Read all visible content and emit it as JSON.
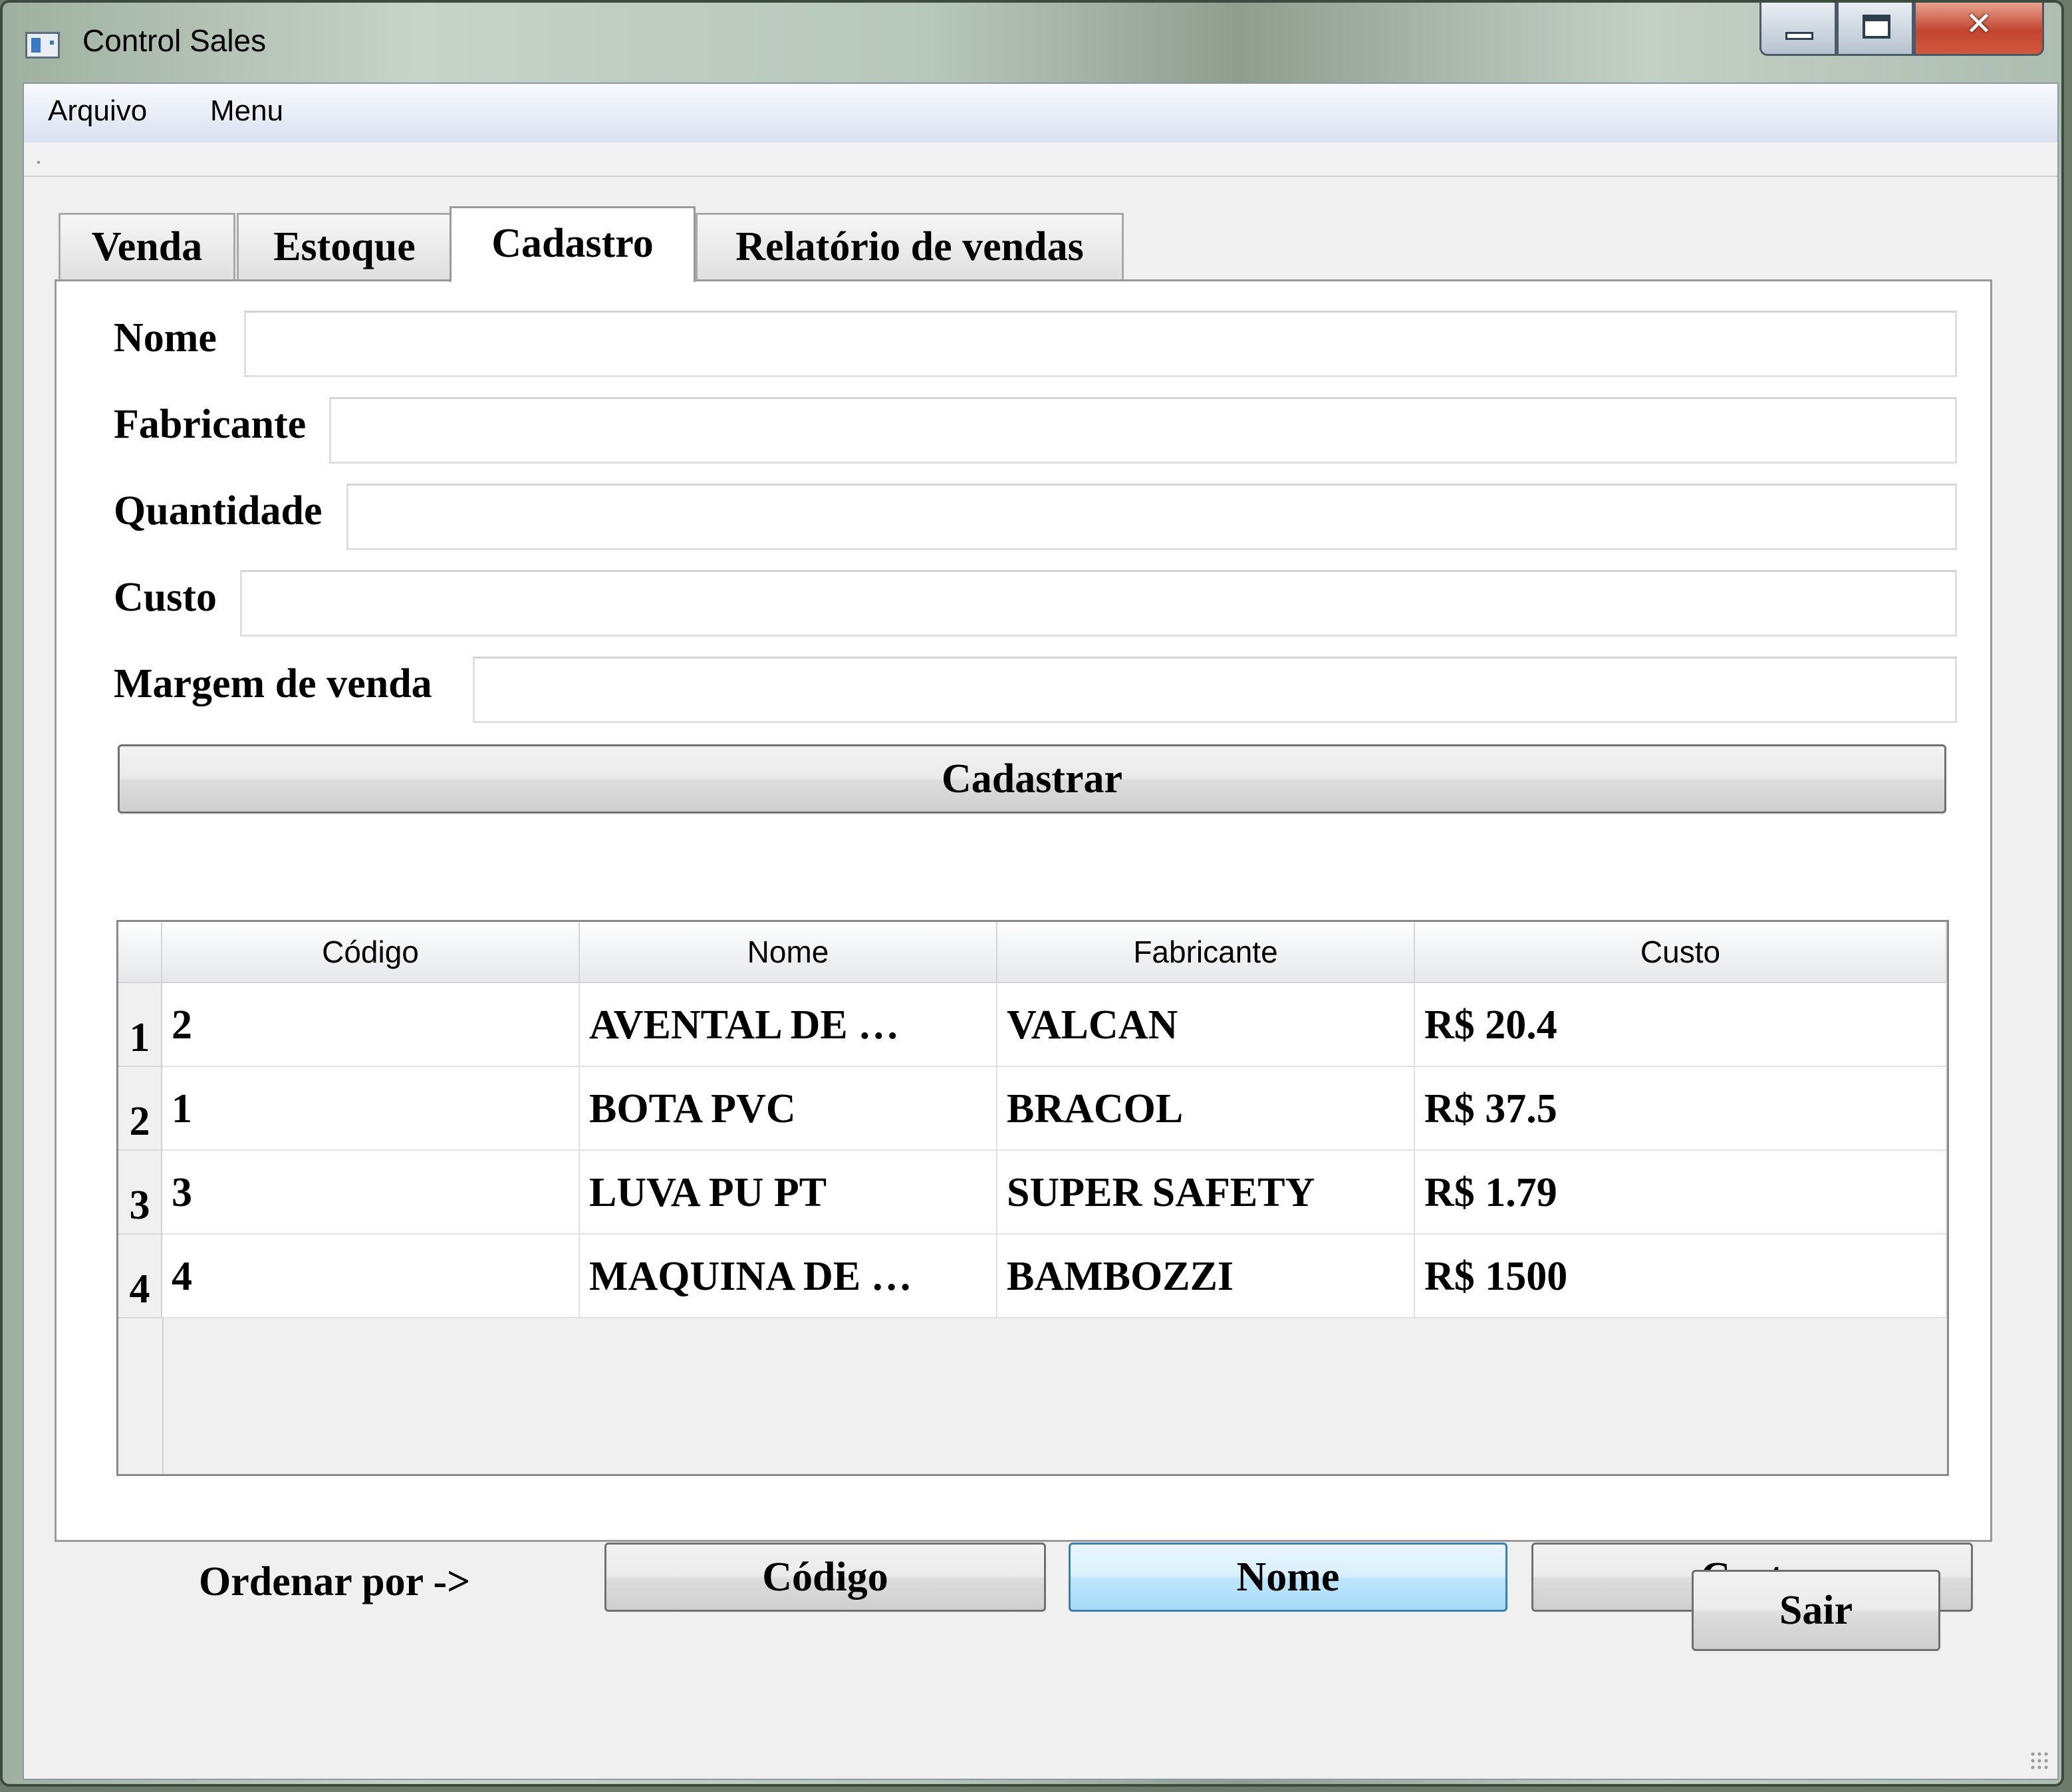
{
  "window": {
    "title": "Control Sales"
  },
  "menu": {
    "items": [
      "Arquivo",
      "Menu"
    ]
  },
  "tabs": [
    "Venda",
    "Estoque",
    "Cadastro",
    "Relatório de vendas"
  ],
  "active_tab": "Cadastro",
  "form": {
    "nome_label": "Nome",
    "fabricante_label": "Fabricante",
    "quantidade_label": "Quantidade",
    "custo_label": "Custo",
    "margem_label": "Margem de venda",
    "nome_value": "",
    "fabricante_value": "",
    "quantidade_value": "",
    "custo_value": "",
    "margem_value": "",
    "submit_label": "Cadastrar"
  },
  "table": {
    "columns": [
      "Código",
      "Nome",
      "Fabricante",
      "Custo"
    ],
    "rows": [
      {
        "num": "1",
        "codigo": "2",
        "nome": "AVENTAL DE …",
        "fabricante": "VALCAN",
        "custo": "R$ 20.4"
      },
      {
        "num": "2",
        "codigo": "1",
        "nome": "BOTA PVC",
        "fabricante": "BRACOL",
        "custo": "R$ 37.5"
      },
      {
        "num": "3",
        "codigo": "3",
        "nome": "LUVA PU PT",
        "fabricante": "SUPER SAFETY",
        "custo": "R$ 1.79"
      },
      {
        "num": "4",
        "codigo": "4",
        "nome": "MAQUINA DE …",
        "fabricante": "BAMBOZZI",
        "custo": "R$ 1500"
      }
    ]
  },
  "sort": {
    "label": "Ordenar por ->",
    "buttons": [
      "Código",
      "Nome",
      "Custo"
    ],
    "active": "Nome"
  },
  "exit_label": "Sair",
  "colors": {
    "accent_active": "#bee6fd",
    "close_button": "#c24530"
  },
  "icons": {
    "app": "app-window-icon",
    "minimize": "minimize-icon",
    "maximize": "maximize-icon",
    "close": "close-icon",
    "resize": "resize-grip-icon"
  }
}
